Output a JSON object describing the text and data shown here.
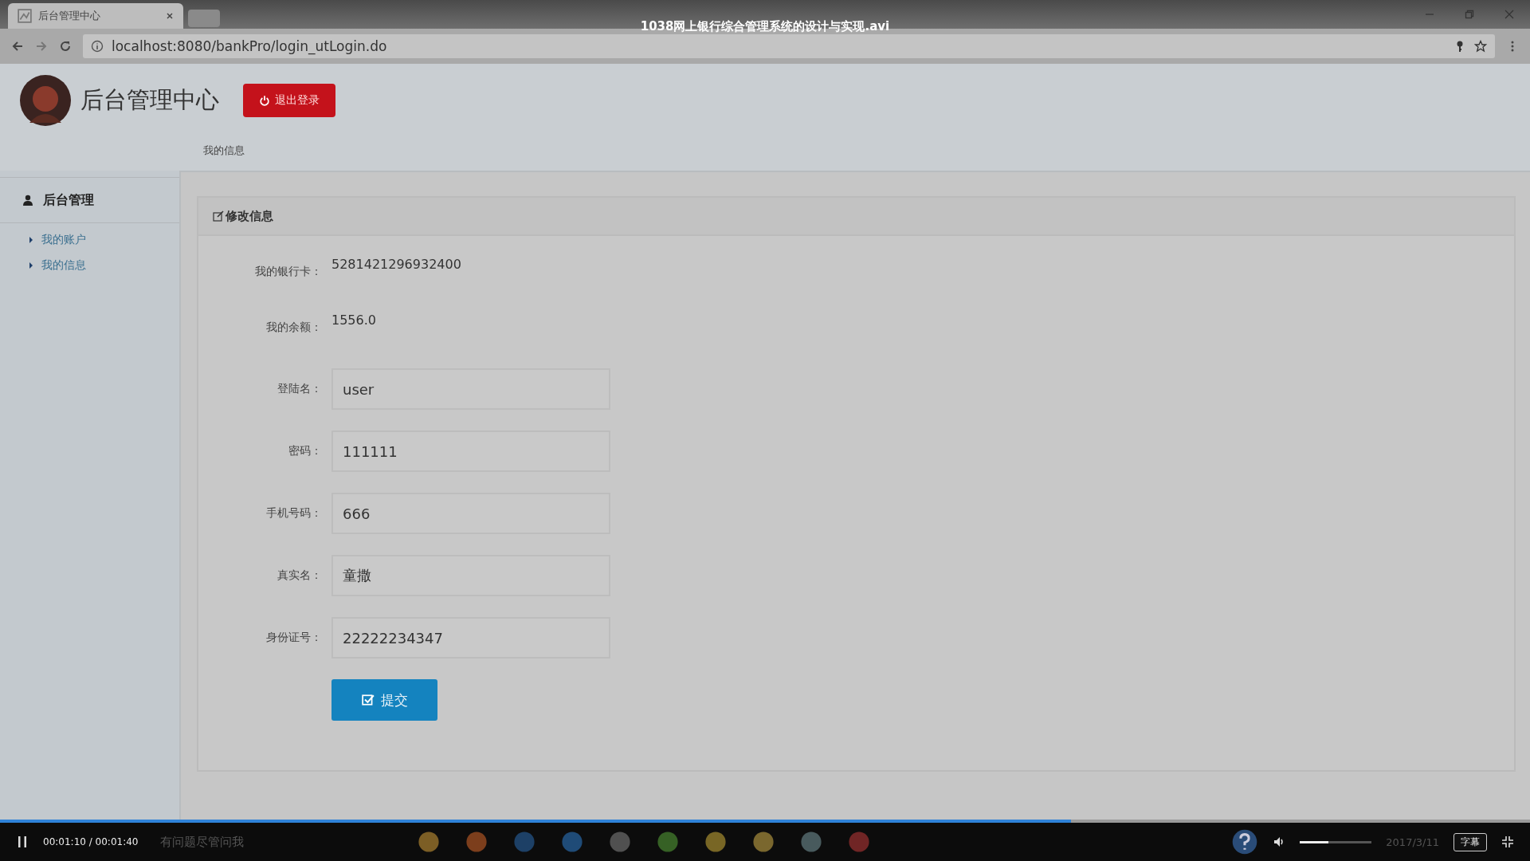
{
  "video_player": {
    "title": "1038网上银行综合管理系统的设计与实现.avi",
    "time": "00:01:10 / 00:01:40",
    "subtitle_button": "字幕",
    "progress": {
      "level": 0.7
    },
    "volume": {
      "level": 0.4
    }
  },
  "browser": {
    "tab_title": "后台管理中心",
    "url": "localhost:8080/bankPro/login_utLogin.do"
  },
  "header": {
    "title": "后台管理中心",
    "logout_button": "退出登录"
  },
  "breadcrumb": "我的信息",
  "sidebar": {
    "heading": "后台管理",
    "items": [
      {
        "label": "我的账户"
      },
      {
        "label": "我的信息"
      }
    ]
  },
  "panel": {
    "title": "修改信息",
    "info": [
      {
        "label": "我的银行卡：",
        "value": "5281421296932400"
      },
      {
        "label": "我的余额：",
        "value": "1556.0"
      }
    ],
    "fields": [
      {
        "label": "登陆名：",
        "value": "user"
      },
      {
        "label": "密码：",
        "value": "111111"
      },
      {
        "label": "手机号码：",
        "value": "666"
      },
      {
        "label": "真实名：",
        "value": "童撒"
      },
      {
        "label": "身份证号：",
        "value": "22222234347"
      }
    ],
    "submit_button": "提交"
  },
  "taskbar": {
    "search_placeholder": "有问题尽管问我",
    "date": "2017/3/11"
  }
}
